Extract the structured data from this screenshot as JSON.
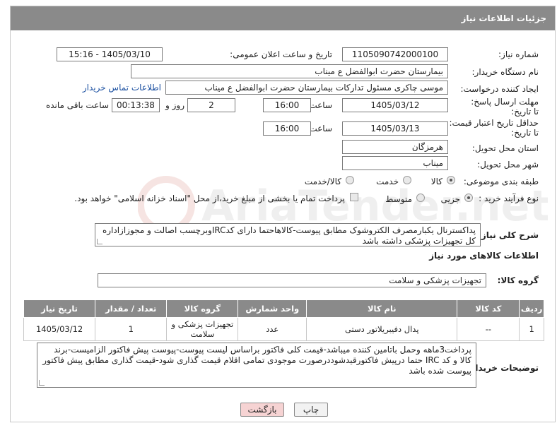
{
  "header": {
    "title": "جزئیات اطلاعات نیاز"
  },
  "fields": {
    "need_number_label": "شماره نیاز:",
    "need_number": "1105090742000100",
    "announce_label": "تاریخ و ساعت اعلان عمومی:",
    "announce_value": "1405/03/10 - 15:16",
    "buyer_org_label": "نام دستگاه خریدار:",
    "buyer_org": "بیمارستان حضرت ابوالفضل ع  میناب",
    "requester_label": "ایجاد کننده درخواست:",
    "requester": "موسی چاکری مسئول تدارکات بیمارستان حضرت ابوالفضل ع  میناب",
    "buyer_contact_link": "اطلاعات تماس خریدار",
    "reply_deadline_label": "مهلت ارسال پاسخ: تا تاریخ:",
    "reply_date": "1405/03/12",
    "time_label": "ساعت",
    "reply_time": "16:00",
    "days_value": "2",
    "days_label": "روز و",
    "remaining_time": "00:13:38",
    "remaining_label": "ساعت باقی مانده",
    "price_valid_label": "حداقل تاریخ اعتبار قیمت: تا تاریخ:",
    "price_valid_date": "1405/03/13",
    "price_valid_time": "16:00",
    "province_label": "استان محل تحویل:",
    "province": "هرمزگان",
    "city_label": "شهر محل تحویل:",
    "city": "میناب",
    "category_label": "طبقه بندی موضوعی:",
    "category_options": [
      "کالا",
      "خدمت",
      "کالا/خدمت"
    ],
    "process_label": "نوع فرآیند خرید :",
    "process_options": [
      "جزیی",
      "متوسط"
    ],
    "payment_note": "پرداخت تمام یا بخشی از مبلغ خرید،از محل \"اسناد خزانه اسلامی\" خواهد بود."
  },
  "description": {
    "label": "شرح کلی نیاز:",
    "text": "پداکسترنال یکبارمصرف الکتروشوک مطابق پیوست-کالاهاحتما دارای کدIRCوبرچسب اصالت و مجوزازاداره کل تجهیزات پزشکی داشته باشد"
  },
  "goods_section": {
    "title": "اطلاعات کالاهای مورد نیاز",
    "group_label": "گروه کالا:",
    "group_value": "تجهیزات پزشکی و سلامت"
  },
  "table": {
    "headers": [
      "ردیف",
      "کد کالا",
      "نام کالا",
      "واحد شمارش",
      "گروه کالا",
      "تعداد / مقدار",
      "تاریخ نیاز"
    ],
    "rows": [
      [
        "1",
        "--",
        "پدال دفیبریلاتور دستی",
        "عدد",
        "تجهیزات پزشکی و سلامت",
        "1",
        "1405/03/12"
      ]
    ]
  },
  "buyer_notes": {
    "label": "توضیحات خریدار:",
    "text": "پرداخت3ماهه وحمل باتامین کننده میباشد-قیمت کلی فاکتور براساس لیست پیوست-پیوست پیش فاکتور الزامیست-برند کالا و کد IRC حتما درپیش فاکتورقیدشوددرصورت موجودی تمامی اقلام قیمت گذاری شود-قیمت گذاری مطابق پیش فاکتور پیوست شده باشد"
  },
  "buttons": {
    "print": "چاپ",
    "back": "بازگشت"
  },
  "watermark": {
    "text": "AriaTender.net"
  },
  "colors": {
    "header_bg": "#8a8a8a",
    "link": "#1a4fa0",
    "back_button_bg": "#f6d3d3",
    "print_button_bg": "#f2f2f2"
  }
}
